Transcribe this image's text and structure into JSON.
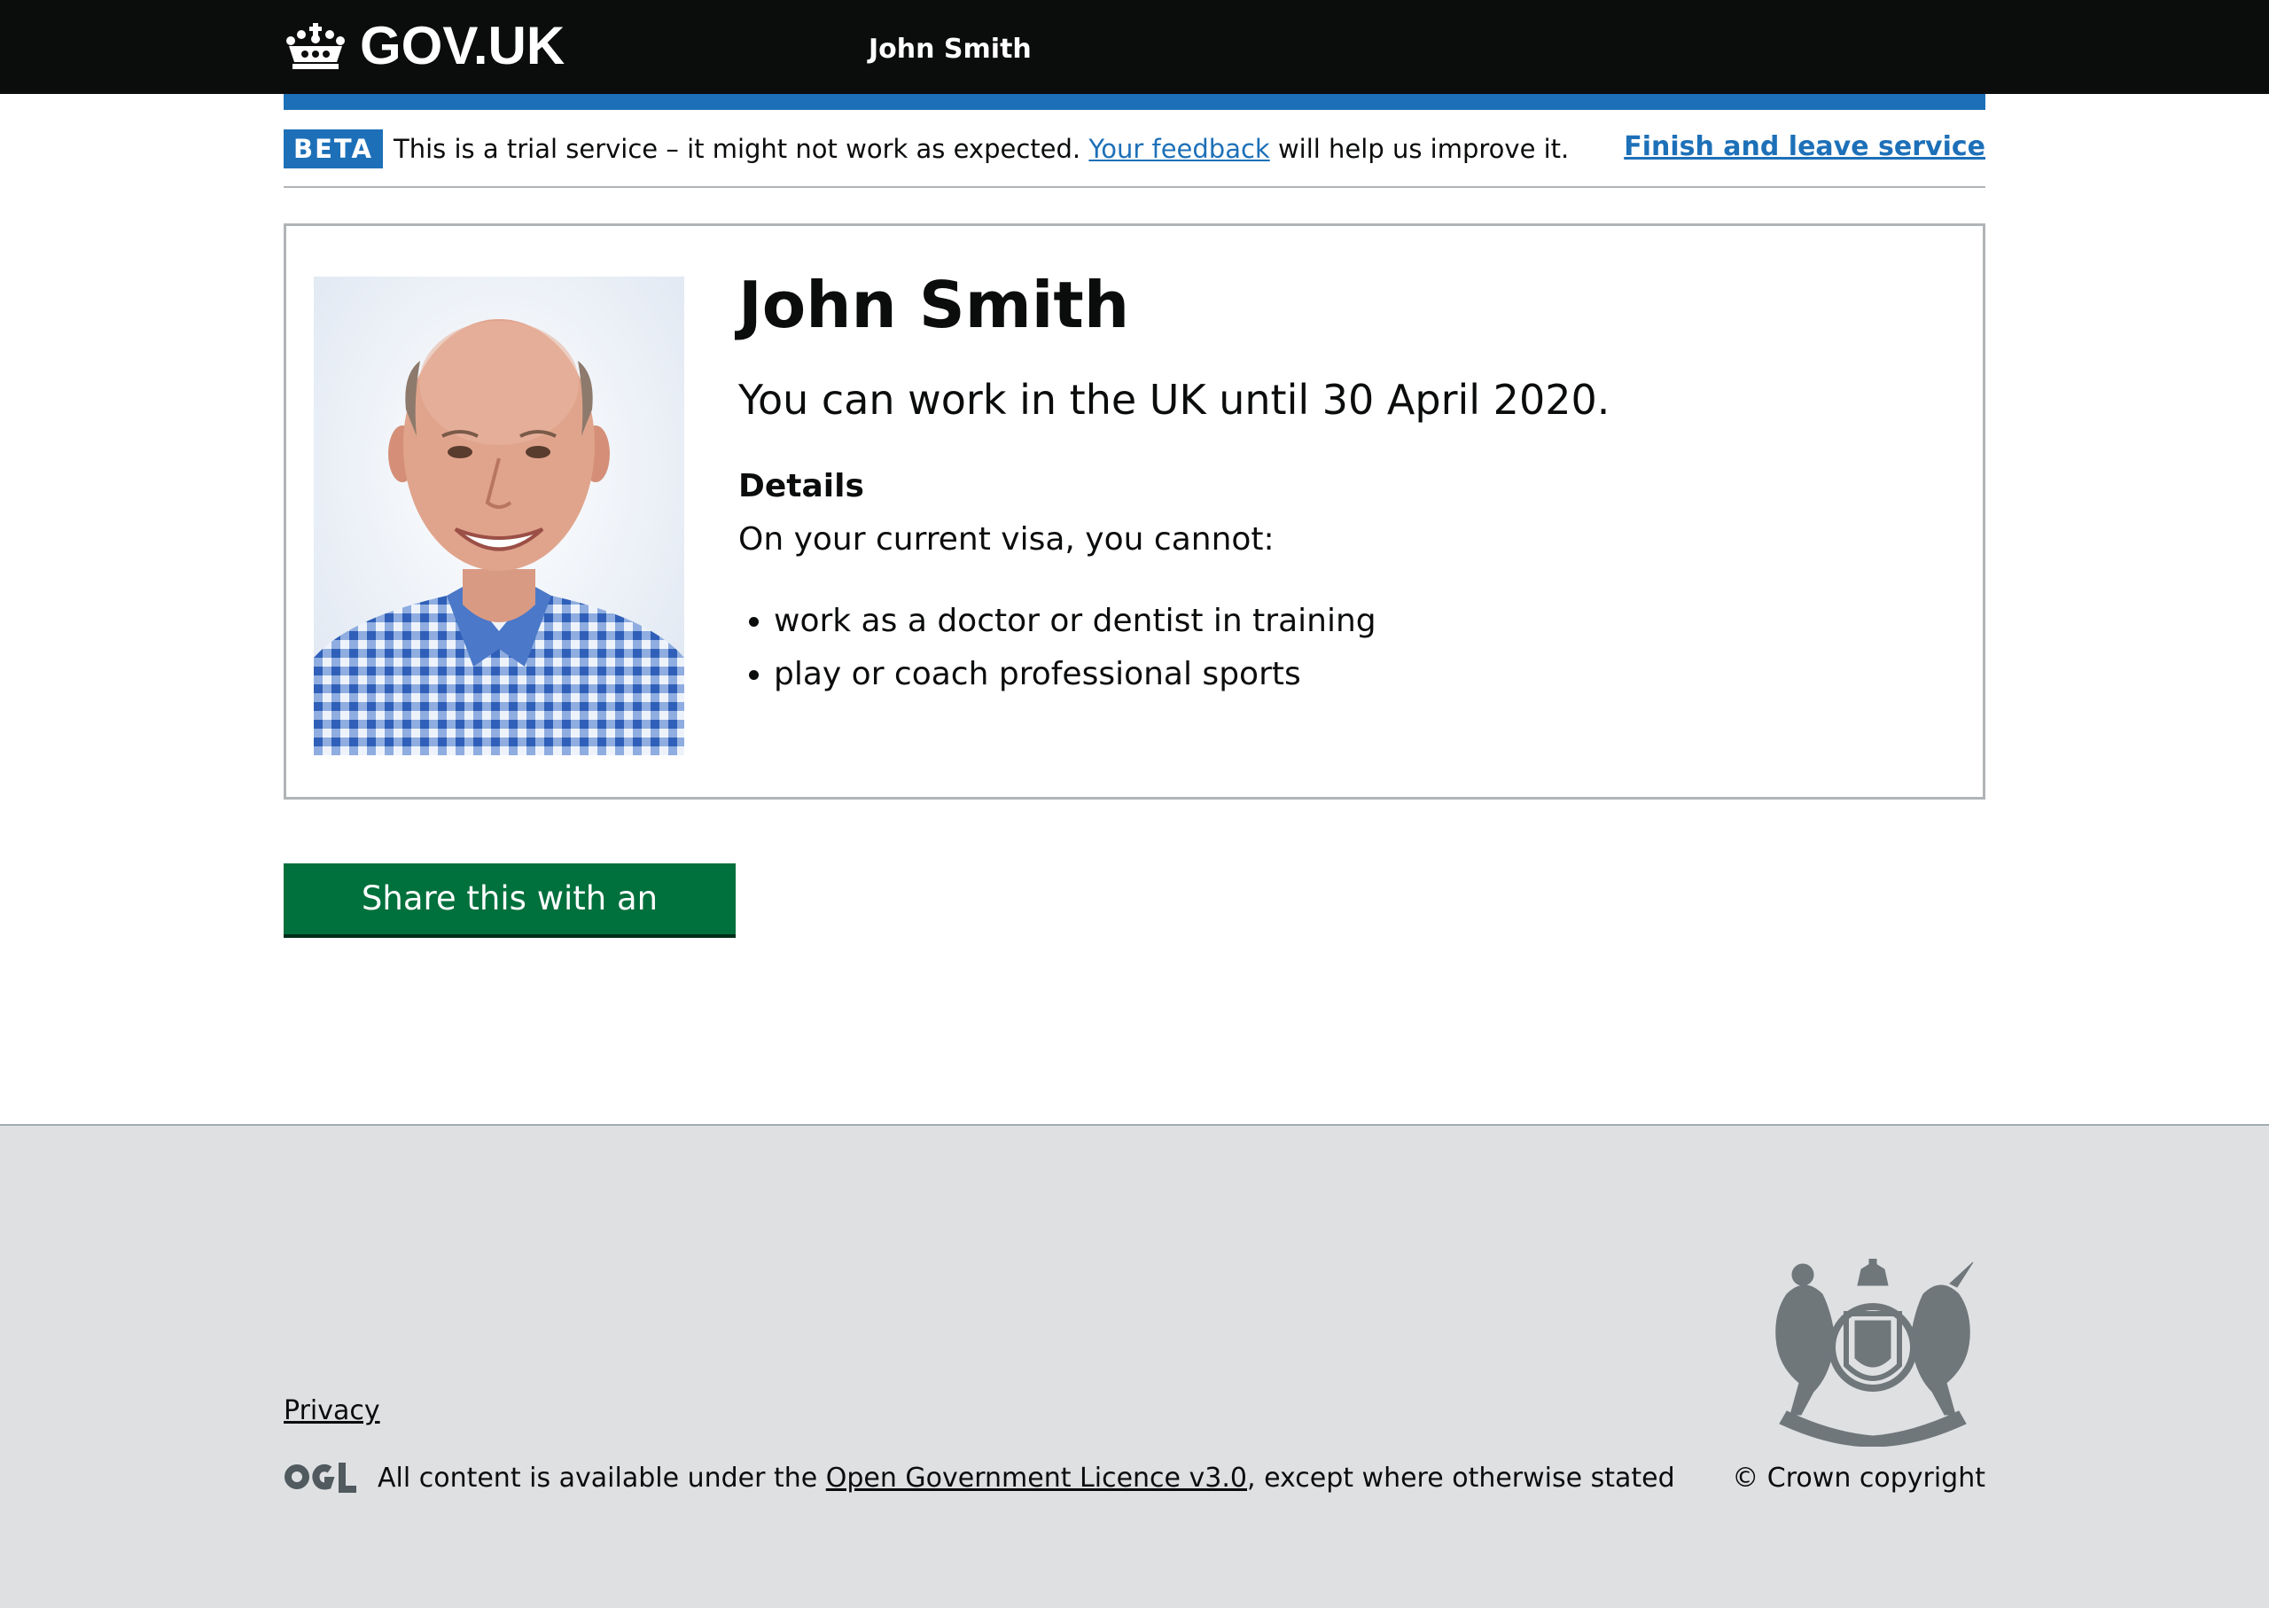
{
  "header": {
    "logo_text": "GOV.UK",
    "service_name": "John Smith",
    "brand_color": "#0b0c0c",
    "accent_bar_color": "#1d70b8"
  },
  "phase_banner": {
    "tag": "BETA",
    "text_before": "This is a trial service – it might not work as expected.",
    "feedback_link": "Your feedback",
    "text_after": "will help us improve it.",
    "finish_link": "Finish and leave service"
  },
  "profile": {
    "photo_icon": "person-photo",
    "name": "John Smith",
    "status": "You can work in the UK until 30 April 2020.",
    "details_heading": "Details",
    "restrictions_intro": "On your current visa, you cannot:",
    "restrictions": [
      "work as a doctor or dentist in training",
      "play or coach professional sports"
    ]
  },
  "actions": {
    "share_button": "Share this with an employer",
    "button_color": "#00703c"
  },
  "footer": {
    "privacy_link": "Privacy",
    "licence_before": "All content is available under the",
    "licence_link": "Open Government Licence v3.0",
    "licence_after": ", except where otherwise stated",
    "ogl_icon": "ogl-logo",
    "crest_icon": "royal-coat-of-arms",
    "copyright": "© Crown copyright"
  }
}
